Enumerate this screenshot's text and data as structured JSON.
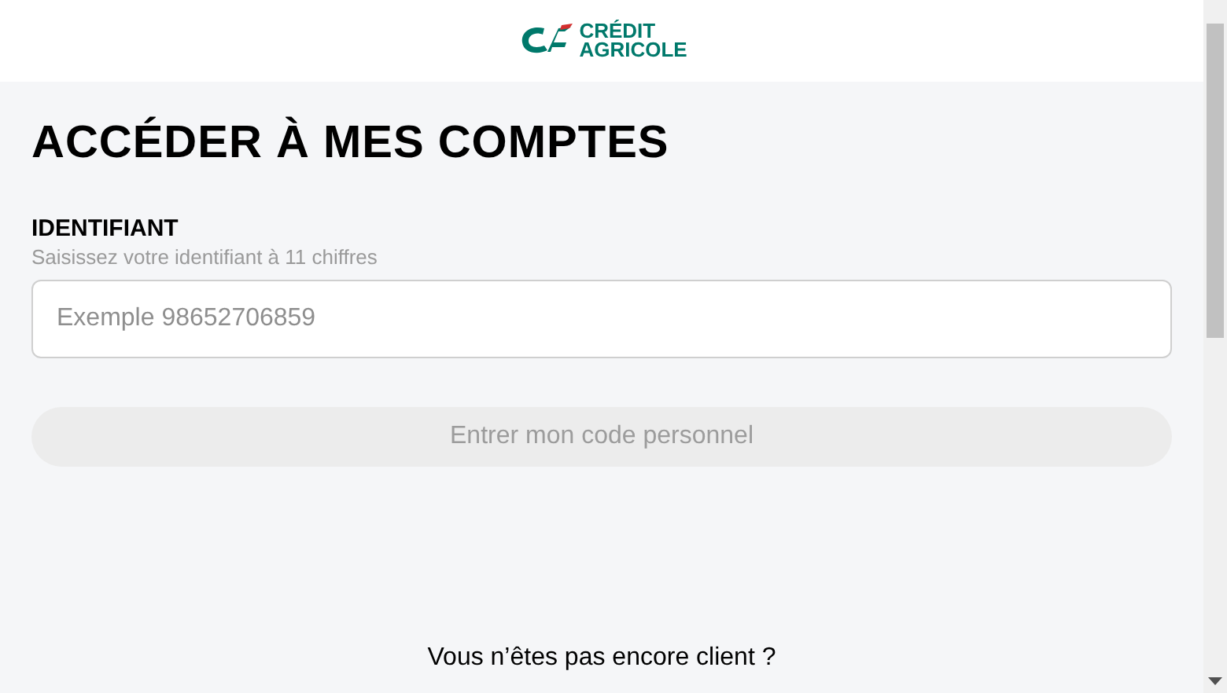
{
  "header": {
    "logo_lines": [
      "CRÉDIT",
      "AGRICOLE"
    ]
  },
  "title": "ACCÉDER À MES COMPTES",
  "identifier": {
    "label": "IDENTIFIANT",
    "hint": "Saisissez votre identifiant à 11 chiffres",
    "placeholder": "Exemple 98652706859"
  },
  "submit": {
    "label": "Entrer mon code personnel",
    "disabled": true
  },
  "footer_question": "Vous n’êtes pas encore client ?"
}
